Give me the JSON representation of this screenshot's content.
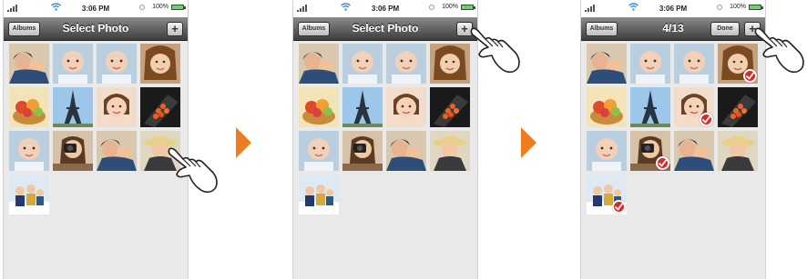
{
  "screens": [
    {
      "status": {
        "time": "3:06 PM",
        "battery_percent": "100%"
      },
      "nav": {
        "left_button": "Albums",
        "title": "Select Photo",
        "right_button": "+"
      },
      "photos": [
        {
          "subject": "mother-child-photo",
          "selected": false
        },
        {
          "subject": "baby-photo",
          "selected": false
        },
        {
          "subject": "baby-photo",
          "selected": false
        },
        {
          "subject": "girl-portrait-photo",
          "selected": false
        },
        {
          "subject": "fruit-basket-photo",
          "selected": false
        },
        {
          "subject": "eiffel-tower-photo",
          "selected": false
        },
        {
          "subject": "child-portrait-photo",
          "selected": false
        },
        {
          "subject": "salmon-roe-photo",
          "selected": false
        },
        {
          "subject": "baby-photo",
          "selected": false
        },
        {
          "subject": "camera-woman-photo",
          "selected": false
        },
        {
          "subject": "mother-child-photo",
          "selected": false
        },
        {
          "subject": "woman-with-hat-photo",
          "selected": false
        },
        {
          "subject": "family-snow-photo",
          "selected": false
        }
      ]
    },
    {
      "status": {
        "time": "3:06 PM",
        "battery_percent": "100%"
      },
      "nav": {
        "left_button": "Albums",
        "title": "Select Photo",
        "right_button": "+"
      },
      "photos": [
        {
          "subject": "mother-child-photo",
          "selected": false
        },
        {
          "subject": "baby-photo",
          "selected": false
        },
        {
          "subject": "baby-photo",
          "selected": false
        },
        {
          "subject": "girl-portrait-photo",
          "selected": false
        },
        {
          "subject": "fruit-basket-photo",
          "selected": false
        },
        {
          "subject": "eiffel-tower-photo",
          "selected": false
        },
        {
          "subject": "child-portrait-photo",
          "selected": false
        },
        {
          "subject": "salmon-roe-photo",
          "selected": false
        },
        {
          "subject": "baby-photo",
          "selected": false
        },
        {
          "subject": "camera-woman-photo",
          "selected": false
        },
        {
          "subject": "mother-child-photo",
          "selected": false
        },
        {
          "subject": "woman-with-hat-photo",
          "selected": false
        },
        {
          "subject": "family-snow-photo",
          "selected": false
        }
      ]
    },
    {
      "status": {
        "time": "3:06 PM",
        "battery_percent": "100%"
      },
      "nav": {
        "left_button": "Albums",
        "title": "4/13",
        "done_button": "Done",
        "right_button": "+"
      },
      "photos": [
        {
          "subject": "mother-child-photo",
          "selected": false
        },
        {
          "subject": "baby-photo",
          "selected": false
        },
        {
          "subject": "baby-photo",
          "selected": false
        },
        {
          "subject": "girl-portrait-photo",
          "selected": true
        },
        {
          "subject": "fruit-basket-photo",
          "selected": false
        },
        {
          "subject": "eiffel-tower-photo",
          "selected": false
        },
        {
          "subject": "child-portrait-photo",
          "selected": true
        },
        {
          "subject": "salmon-roe-photo",
          "selected": false
        },
        {
          "subject": "baby-photo",
          "selected": false
        },
        {
          "subject": "camera-woman-photo",
          "selected": true
        },
        {
          "subject": "mother-child-photo",
          "selected": false
        },
        {
          "subject": "woman-with-hat-photo",
          "selected": false
        },
        {
          "subject": "family-snow-photo",
          "selected": true
        }
      ]
    }
  ],
  "colors": {
    "step_arrow": "#f07d1d",
    "check_badge": "#d92a2a",
    "navbar_dark": "#3d3d3d",
    "background": "#e9e9e9"
  },
  "icons": [
    "signal-icon",
    "wifi-icon",
    "lock-rotation-icon",
    "battery-icon",
    "hand-pointer-icon",
    "checkmark-icon",
    "step-arrow-icon"
  ]
}
